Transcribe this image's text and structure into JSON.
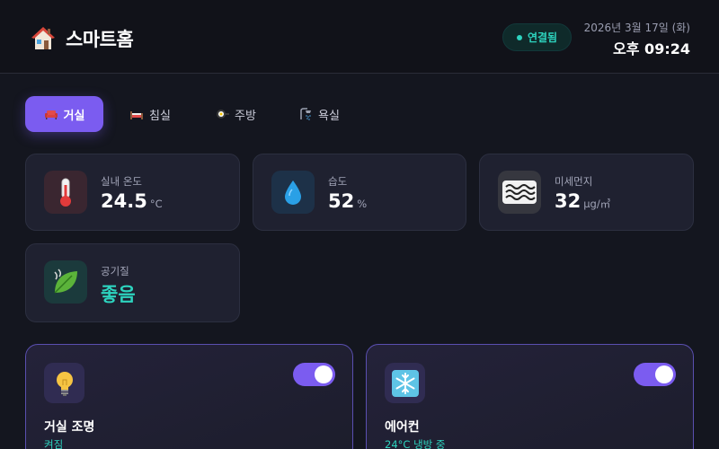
{
  "header": {
    "title": "스마트홈",
    "connection": "연결됨",
    "date": "2026년 3월 17일 (화)",
    "time": "오후 09:24"
  },
  "tabs": [
    {
      "label": "거실",
      "icon": "sofa-icon",
      "active": true
    },
    {
      "label": "침실",
      "icon": "bed-icon",
      "active": false
    },
    {
      "label": "주방",
      "icon": "cooking-icon",
      "active": false
    },
    {
      "label": "욕실",
      "icon": "shower-icon",
      "active": false
    }
  ],
  "sensors": [
    {
      "label": "실내 온도",
      "value": "24.5",
      "unit": "°C",
      "icon": "thermometer-icon"
    },
    {
      "label": "습도",
      "value": "52",
      "unit": "%",
      "icon": "water-drop-icon"
    },
    {
      "label": "미세먼지",
      "value": "32",
      "unit": "μg/㎥",
      "icon": "wave-icon"
    },
    {
      "label": "공기질",
      "value": "좋음",
      "unit": "",
      "icon": "leaf-icon"
    }
  ],
  "devices": [
    {
      "name": "거실 조명",
      "status": "켜짐",
      "icon": "light-bulb-icon",
      "on": true
    },
    {
      "name": "에어컨",
      "status": "24°C 냉방 중",
      "icon": "snowflake-icon",
      "on": true
    }
  ],
  "colors": {
    "accent": "#7b5cf0",
    "success": "#2dd4bf",
    "background": "#14161f"
  }
}
